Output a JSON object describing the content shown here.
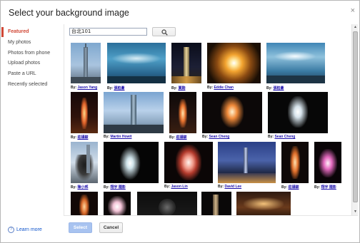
{
  "dialog": {
    "title": "Select your background image",
    "close_glyph": "×"
  },
  "sidebar": {
    "items": [
      {
        "label": "Featured",
        "active": true
      },
      {
        "label": "My photos"
      },
      {
        "label": "Photos from phone"
      },
      {
        "label": "Upload photos"
      },
      {
        "label": "Paste a URL"
      },
      {
        "label": "Recently selected"
      }
    ],
    "learn_more": "Learn more",
    "help_glyph": "?"
  },
  "search": {
    "value": "台北101",
    "button_icon": "search-icon"
  },
  "grid": {
    "by_label": "By:",
    "photos": [
      {
        "author": "Jason Yang"
      },
      {
        "author": "張柏蒼"
      },
      {
        "author": "賈駒"
      },
      {
        "author": "Eddie Chan"
      },
      {
        "author": "張柏蒼"
      },
      {
        "author": "莊謹駿"
      },
      {
        "author": "Martin Howit"
      },
      {
        "author": "莊謹駿"
      },
      {
        "author": "Sean Cheng"
      },
      {
        "author": "Sean Cheng"
      },
      {
        "author": "陳小邦"
      },
      {
        "author": "翔宇 隨影"
      },
      {
        "author": "Jason Lin"
      },
      {
        "author": "David Lee"
      },
      {
        "author": "莊謹駿"
      },
      {
        "author": "翔宇 隨影"
      }
    ]
  },
  "footer": {
    "select_label": "Select",
    "cancel_label": "Cancel"
  },
  "colors": {
    "accent": "#d14836",
    "link": "#1a0dab",
    "select_button": "#a8c3f0"
  }
}
